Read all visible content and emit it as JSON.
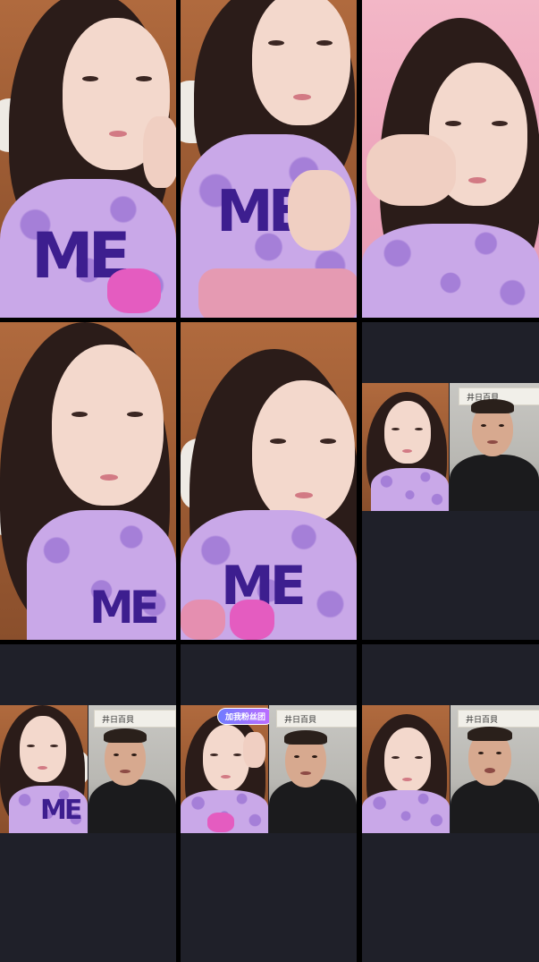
{
  "cells": [
    {
      "id": "r1c1",
      "kind": "single-video"
    },
    {
      "id": "r1c2",
      "kind": "single-video"
    },
    {
      "id": "r1c3",
      "kind": "single-video"
    },
    {
      "id": "r2c1",
      "kind": "single-video"
    },
    {
      "id": "r2c2",
      "kind": "single-video"
    },
    {
      "id": "r2c3",
      "kind": "split-call"
    },
    {
      "id": "r3c1",
      "kind": "split-call"
    },
    {
      "id": "r3c2",
      "kind": "split-call"
    },
    {
      "id": "r3c3",
      "kind": "split-call"
    }
  ],
  "badge_text": "加我粉丝团",
  "shirt_letters": "ME",
  "calligraphy_text": "井日百貝",
  "colors": {
    "empty_cell_background": "#1f2029",
    "divider": "#000000",
    "shirt_lavender": "#c9a8e8",
    "shirt_print": "#3d1e8f",
    "bow_pink": "#e45cc0"
  }
}
